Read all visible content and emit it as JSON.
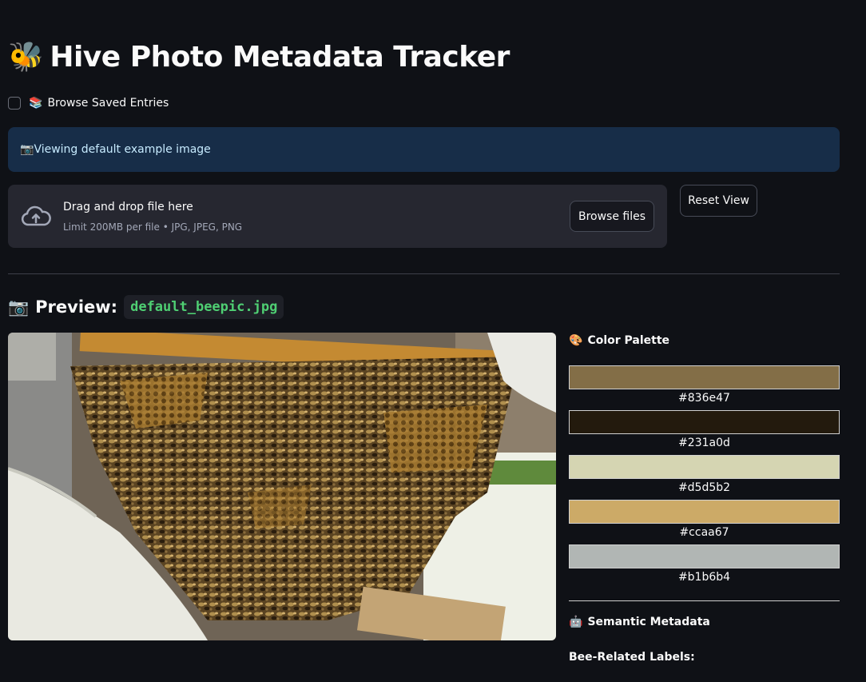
{
  "header": {
    "emoji": "🐝",
    "title": "Hive Photo Metadata Tracker"
  },
  "browse": {
    "emoji": "📚",
    "label": "Browse Saved Entries",
    "checked": false
  },
  "info": {
    "emoji": "📷",
    "text": "Viewing default example image"
  },
  "uploader": {
    "title": "Drag and drop file here",
    "limit": "Limit 200MB per file • JPG, JPEG, PNG",
    "browse_label": "Browse files"
  },
  "reset_label": "Reset View",
  "preview": {
    "emoji": "📷",
    "label": "Preview:",
    "filename": "default_beepic.jpg"
  },
  "palette": {
    "emoji": "🎨",
    "title": "Color Palette",
    "colors": [
      {
        "hex": "#836e47"
      },
      {
        "hex": "#231a0d"
      },
      {
        "hex": "#d5d5b2"
      },
      {
        "hex": "#ccaa67"
      },
      {
        "hex": "#b1b6b4"
      }
    ]
  },
  "semantic": {
    "emoji": "🤖",
    "title": "Semantic Metadata",
    "bee_labels_heading": "Bee-Related Labels:"
  }
}
